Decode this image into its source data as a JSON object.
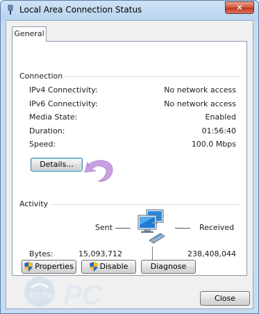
{
  "window": {
    "title": "Local Area Connection Status"
  },
  "tabs": [
    {
      "label": "General"
    }
  ],
  "connection": {
    "heading": "Connection",
    "rows": [
      {
        "label": "IPv4 Connectivity:",
        "value": "No network access"
      },
      {
        "label": "IPv6 Connectivity:",
        "value": "No network access"
      },
      {
        "label": "Media State:",
        "value": "Enabled"
      },
      {
        "label": "Duration:",
        "value": "01:56:40"
      },
      {
        "label": "Speed:",
        "value": "100.0 Mbps"
      }
    ],
    "details_button": "Details..."
  },
  "activity": {
    "heading": "Activity",
    "sent_label": "Sent",
    "received_label": "Received",
    "bytes_label": "Bytes:",
    "bytes_sent": "15,093,712",
    "bytes_received": "238,408,044"
  },
  "buttons": {
    "properties": "Properties",
    "disable": "Disable",
    "diagnose": "Diagnose",
    "close": "Close"
  },
  "colors": {
    "arrow": "#c8a0e0",
    "title_bg": "#b9d3ee",
    "close_red": "#c03a22"
  }
}
